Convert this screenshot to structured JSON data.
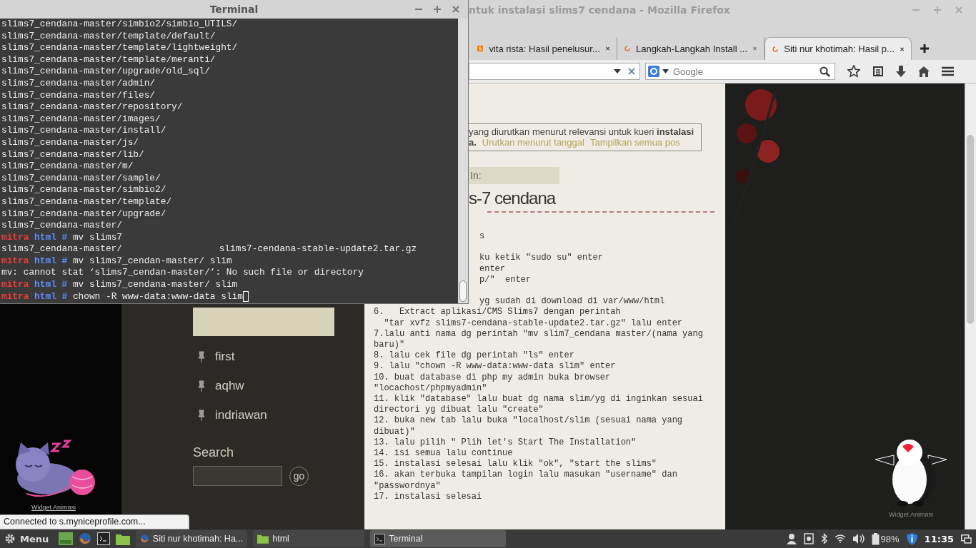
{
  "firefox": {
    "title": "ntuk instalasi slims7 cendana - Mozilla Firefox",
    "tabs": [
      {
        "label": "vita rista: Hasil penelusur...",
        "kind": "blogger",
        "selected": false
      },
      {
        "label": "Langkah-Langkah Install ...",
        "kind": "loading",
        "selected": false
      },
      {
        "label": "Siti nur khotimah: Hasil p...",
        "kind": "loading",
        "selected": true
      }
    ],
    "search": {
      "placeholder": "Google"
    }
  },
  "page": {
    "notice": {
      "text": "yang diurutkan menurut relevansi untuk kueri **instalasi**",
      "tail": "a.",
      "links": [
        "Urutkan menurut tanggal",
        "Tampilkan semua pos"
      ]
    },
    "posted_in": "In:",
    "post_title": "s-7 cendana",
    "post_lines": [
      {
        "kind": "cut",
        "text": "s"
      },
      {
        "kind": "blank"
      },
      {
        "kind": "cut",
        "text": "ku ketik \"sudo su\" enter"
      },
      {
        "kind": "cut",
        "text": "enter"
      },
      {
        "kind": "cut",
        "text": "p/\"  enter"
      },
      {
        "kind": "blank"
      },
      {
        "kind": "cut",
        "text": "yg sudah di download di var/www/html"
      },
      {
        "kind": "line",
        "text": "6.   Extract aplikasi/CMS Slims7 dengan perintah"
      },
      {
        "kind": "line",
        "text": "  \"tar xvfz slims7-cendana-stable-update2.tar.gz\" lalu enter"
      },
      {
        "kind": "line",
        "text": "7.lalu anti nama dg perintah \"mv slim7_cendana master/(nama yang baru)\""
      },
      {
        "kind": "line",
        "text": "8. lalu cek file dg perintah \"ls\" enter"
      },
      {
        "kind": "line",
        "text": "9. lalu \"chown -R www-data:www-data slim\" enter"
      },
      {
        "kind": "line",
        "text": "10. buat database di php my admin buka browser \"locachost/phpmyadmin\""
      },
      {
        "kind": "line",
        "text": "11. klik \"database\" lalu buat dg nama slim/yg di inginkan sesuai directori yg dibuat lalu \"create\""
      },
      {
        "kind": "line",
        "text": "12. buka new tab lalu buka \"localhost/slim (sesuai nama yang dibuat)\""
      },
      {
        "kind": "line",
        "text": "13. lalu pilih \" Plih let's Start The Installation\""
      },
      {
        "kind": "line",
        "text": "14. isi semua lalu continue"
      },
      {
        "kind": "line",
        "text": "15. instalasi selesai lalu klik \"ok\", \"start the slims\""
      },
      {
        "kind": "line",
        "text": "16. akan terbuka tampilan login lalu masukan \"username\" dan \"passwordnya\""
      },
      {
        "kind": "line",
        "text": "17. instalasi selesai"
      }
    ],
    "sidebar": {
      "labels": [
        "first",
        "aqhw",
        "indriawan"
      ],
      "search_heading": "Search",
      "search_button": "go"
    },
    "widgets": [
      {
        "kind": "cat",
        "caption": "Widget Animasi"
      },
      {
        "kind": "penguin",
        "caption": "Widget Animasi"
      }
    ],
    "status": "Connected to s.myniceprofile.com..."
  },
  "terminal": {
    "title": "Terminal",
    "lines": [
      {
        "kind": "output",
        "text": "slims7_cendana-master/simbio2/simbio_UTILS/"
      },
      {
        "kind": "output",
        "text": "slims7_cendana-master/template/default/"
      },
      {
        "kind": "output",
        "text": "slims7_cendana-master/template/lightweight/"
      },
      {
        "kind": "output",
        "text": "slims7_cendana-master/template/meranti/"
      },
      {
        "kind": "output",
        "text": "slims7_cendana-master/upgrade/old_sql/"
      },
      {
        "kind": "output",
        "text": "slims7_cendana-master/admin/"
      },
      {
        "kind": "output",
        "text": "slims7_cendana-master/files/"
      },
      {
        "kind": "output",
        "text": "slims7_cendana-master/repository/"
      },
      {
        "kind": "output",
        "text": "slims7_cendana-master/images/"
      },
      {
        "kind": "output",
        "text": "slims7_cendana-master/install/"
      },
      {
        "kind": "output",
        "text": "slims7_cendana-master/js/"
      },
      {
        "kind": "output",
        "text": "slims7_cendana-master/lib/"
      },
      {
        "kind": "output",
        "text": "slims7_cendana-master/m/"
      },
      {
        "kind": "output",
        "text": "slims7_cendana-master/sample/"
      },
      {
        "kind": "output",
        "text": "slims7_cendana-master/simbio2/"
      },
      {
        "kind": "output",
        "text": "slims7_cendana-master/template/"
      },
      {
        "kind": "output",
        "text": "slims7_cendana-master/upgrade/"
      },
      {
        "kind": "output",
        "text": "slims7_cendana-master/"
      },
      {
        "kind": "prompt",
        "user": "mitra",
        "dir": "html",
        "symbol": "#",
        "command": "mv slims7",
        "cursor": false
      },
      {
        "kind": "columns",
        "cells": [
          "slims7_cendana-master/",
          "slims7-cendana-stable-update2.tar.gz"
        ]
      },
      {
        "kind": "prompt",
        "user": "mitra",
        "dir": "html",
        "symbol": "#",
        "command": "mv slims7_cendan-master/ slim",
        "cursor": false
      },
      {
        "kind": "output",
        "text": "mv: cannot stat ‘slims7_cendan-master/’: No such file or directory"
      },
      {
        "kind": "prompt",
        "user": "mitra",
        "dir": "html",
        "symbol": "#",
        "command": "mv slims7_cendana-master/ slim",
        "cursor": false
      },
      {
        "kind": "prompt",
        "user": "mitra",
        "dir": "html",
        "symbol": "#",
        "command": "chown -R www-data:www-data slim",
        "cursor": true
      }
    ]
  },
  "taskbar": {
    "menu": "Menu",
    "tasks": [
      {
        "label": "Siti nur khotimah: Ha...",
        "kind": "firefox",
        "selected": false
      },
      {
        "label": "html",
        "kind": "folder",
        "selected": false
      },
      {
        "label": "Terminal",
        "kind": "terminal",
        "selected": true
      }
    ],
    "battery": "98%",
    "clock": "11:35"
  }
}
